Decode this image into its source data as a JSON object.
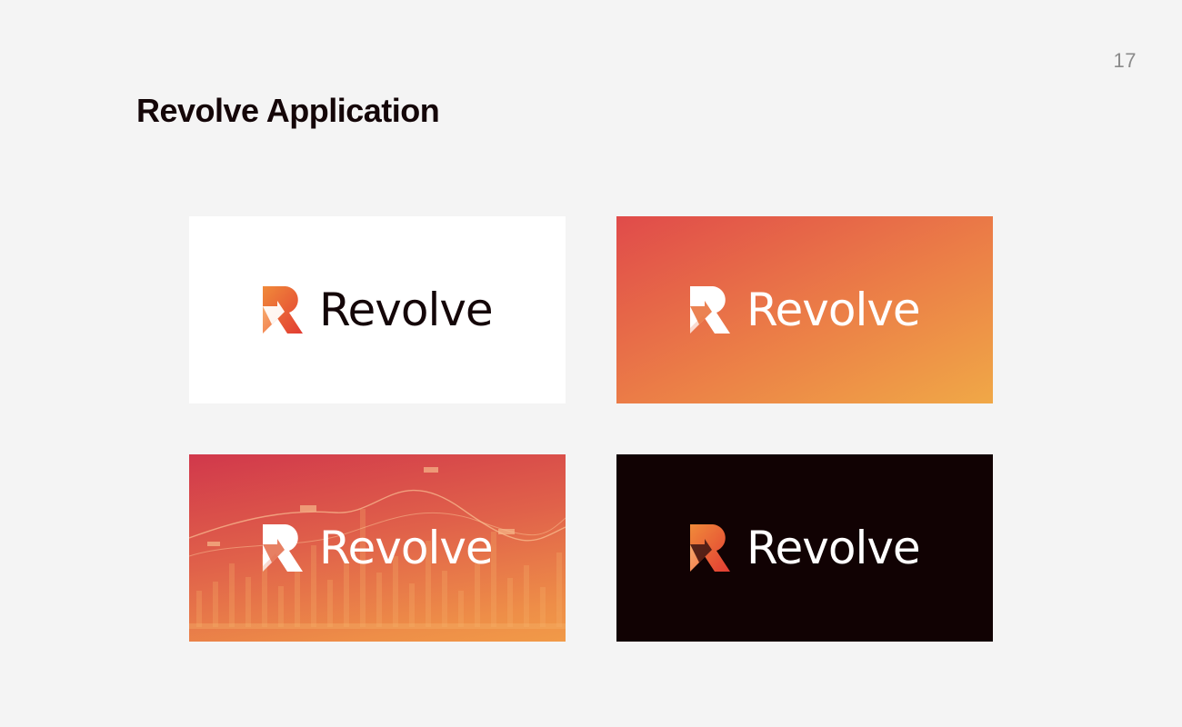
{
  "page": {
    "number": "17",
    "title": "Revolve Application"
  },
  "panels": [
    {
      "variant": "white-background",
      "background": "#ffffff",
      "wordmark": "Revolve",
      "wordmark_color": "#140608",
      "mark_style": "gradient",
      "icon": "revolve-logo-mark-icon"
    },
    {
      "variant": "gradient-background",
      "background": "#e04b4a → #f0a847",
      "wordmark": "Revolve",
      "wordmark_color": "#ffffff",
      "mark_style": "white",
      "icon": "revolve-logo-mark-icon"
    },
    {
      "variant": "photo-chart-background",
      "background": "#d1384b → #f19a48",
      "wordmark": "Revolve",
      "wordmark_color": "#ffffff",
      "mark_style": "white",
      "icon": "revolve-logo-mark-icon"
    },
    {
      "variant": "dark-background",
      "background": "#110203",
      "wordmark": "Revolve",
      "wordmark_color": "#ffffff",
      "mark_style": "gradient",
      "icon": "revolve-logo-mark-icon"
    }
  ],
  "colors": {
    "brand_red": "#e04b4a",
    "brand_orange": "#f0a847",
    "ink": "#140608",
    "slide_background": "#f4f4f4"
  }
}
